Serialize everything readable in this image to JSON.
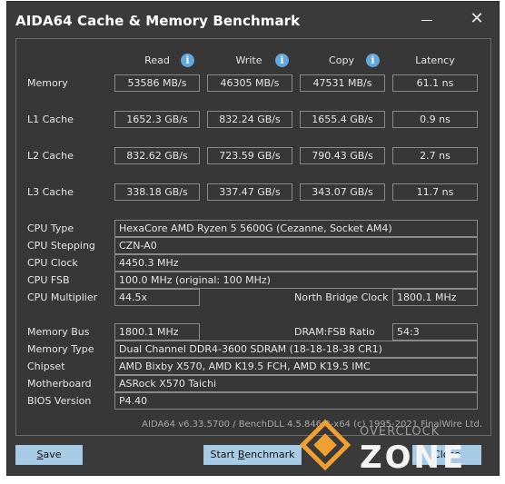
{
  "window": {
    "title": "AIDA64 Cache & Memory Benchmark",
    "minimize_glyph": "–",
    "close_glyph": "✕"
  },
  "columns": {
    "read": "Read",
    "write": "Write",
    "copy": "Copy",
    "latency": "Latency",
    "info_glyph": "i"
  },
  "benchmarks": [
    {
      "label": "Memory",
      "read": "53586 MB/s",
      "write": "46305 MB/s",
      "copy": "47531 MB/s",
      "latency": "61.1 ns"
    },
    {
      "label": "L1 Cache",
      "read": "1652.3 GB/s",
      "write": "832.24 GB/s",
      "copy": "1655.4 GB/s",
      "latency": "0.9 ns"
    },
    {
      "label": "L2 Cache",
      "read": "832.62 GB/s",
      "write": "723.59 GB/s",
      "copy": "790.43 GB/s",
      "latency": "2.7 ns"
    },
    {
      "label": "L3 Cache",
      "read": "338.18 GB/s",
      "write": "337.47 GB/s",
      "copy": "343.07 GB/s",
      "latency": "11.7 ns"
    }
  ],
  "cpu": {
    "type_label": "CPU Type",
    "type_value": "HexaCore AMD Ryzen 5 5600G  (Cezanne, Socket AM4)",
    "stepping_label": "CPU Stepping",
    "stepping_value": "CZN-A0",
    "clock_label": "CPU Clock",
    "clock_value": "4450.3 MHz",
    "fsb_label": "CPU FSB",
    "fsb_value": "100.0 MHz  (original: 100 MHz)",
    "multiplier_label": "CPU Multiplier",
    "multiplier_value": "44.5x",
    "nb_clock_label": "North Bridge Clock",
    "nb_clock_value": "1800.1 MHz"
  },
  "memory": {
    "bus_label": "Memory Bus",
    "bus_value": "1800.1 MHz",
    "ratio_label": "DRAM:FSB Ratio",
    "ratio_value": "54:3",
    "type_label": "Memory Type",
    "type_value": "Dual Channel DDR4-3600 SDRAM  (18-18-18-38 CR1)",
    "chipset_label": "Chipset",
    "chipset_value": "AMD Bixby X570, AMD K19.5 FCH, AMD K19.5 IMC",
    "motherboard_label": "Motherboard",
    "motherboard_value": "ASRock X570 Taichi",
    "bios_label": "BIOS Version",
    "bios_value": "P4.40"
  },
  "footer": "AIDA64 v6.33.5700 / BenchDLL 4.5.846.8-x64  (c) 1995-2021 FinalWire Ltd.",
  "buttons": {
    "save_prefix": "S",
    "save_rest": "ave",
    "start_prefix": "Start ",
    "start_underline": "B",
    "start_rest": "enchmark",
    "close": "Close"
  },
  "watermark": {
    "top": "OVERCLOCK",
    "bottom": "ZONE"
  }
}
